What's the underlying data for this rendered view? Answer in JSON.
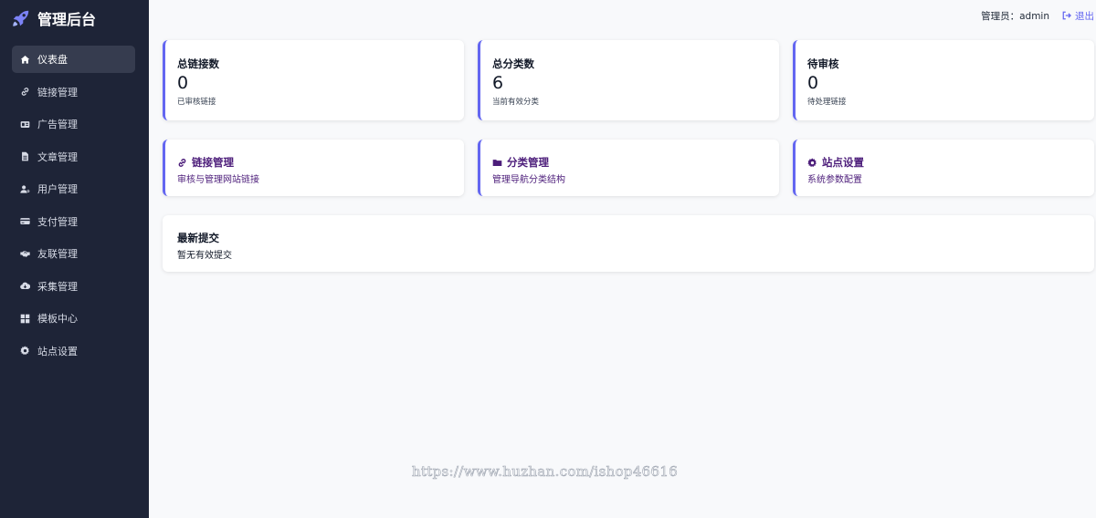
{
  "brand": {
    "title": "管理后台",
    "icon": "rocket-icon",
    "accent": "#6366f1"
  },
  "sidebar": {
    "items": [
      {
        "label": "仪表盘",
        "icon": "home-icon",
        "active": true
      },
      {
        "label": "链接管理",
        "icon": "link-icon"
      },
      {
        "label": "广告管理",
        "icon": "ad-icon"
      },
      {
        "label": "文章管理",
        "icon": "file-icon"
      },
      {
        "label": "用户管理",
        "icon": "user-cog-icon"
      },
      {
        "label": "支付管理",
        "icon": "credit-card-icon"
      },
      {
        "label": "友联管理",
        "icon": "handshake-icon"
      },
      {
        "label": "采集管理",
        "icon": "cloud-download-icon"
      },
      {
        "label": "模板中心",
        "icon": "grid-icon"
      },
      {
        "label": "站点设置",
        "icon": "gear-icon"
      }
    ]
  },
  "header": {
    "admin_label": "管理员：admin",
    "logout_label": "退出"
  },
  "stats": [
    {
      "title": "总链接数",
      "value": "0",
      "desc": "已审核链接"
    },
    {
      "title": "总分类数",
      "value": "6",
      "desc": "当前有效分类"
    },
    {
      "title": "待审核",
      "value": "0",
      "desc": "待处理链接"
    }
  ],
  "quick_links": [
    {
      "title": "链接管理",
      "desc": "审核与管理网站链接",
      "icon": "link-icon"
    },
    {
      "title": "分类管理",
      "desc": "管理导航分类结构",
      "icon": "folder-icon"
    },
    {
      "title": "站点设置",
      "desc": "系统参数配置",
      "icon": "gear-icon"
    }
  ],
  "recent": {
    "title": "最新提交",
    "empty_text": "暂无有效提交"
  },
  "watermark": "https://www.huzhan.com/ishop46616"
}
